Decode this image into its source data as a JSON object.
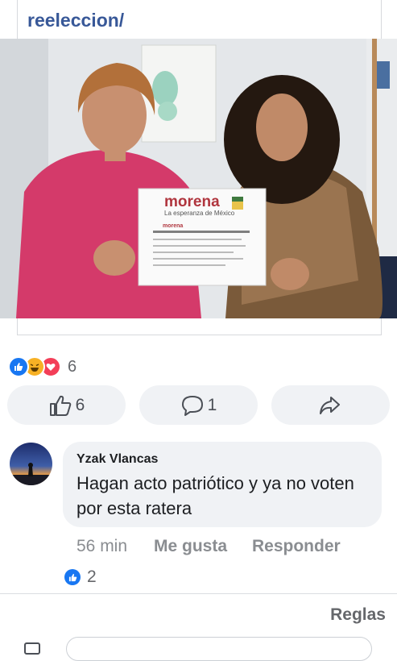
{
  "post": {
    "link_fragment": "reeleccion/"
  },
  "photo": {
    "paper_brand": "morena",
    "paper_subtitle": "La esperanza de México",
    "paper_small_brand": "morena"
  },
  "reactions": {
    "count": "6",
    "icons": [
      "like-icon",
      "haha-icon",
      "love-icon"
    ]
  },
  "actions": {
    "like_count": "6",
    "comment_count": "1"
  },
  "comment": {
    "author": "Yzak Vlancas",
    "text": "Hagan acto patriótico y ya no voten por esta ratera",
    "time": "56 min",
    "like_label": "Me gusta",
    "reply_label": "Responder",
    "reaction_count": "2"
  },
  "footer": {
    "rules_label": "Reglas"
  },
  "colors": {
    "link": "#385898",
    "like_blue": "#1877f2",
    "haha_yellow": "#f7b125",
    "love_red": "#f33e58",
    "button_bg": "#f0f2f5",
    "morena_red": "#b0353e"
  }
}
